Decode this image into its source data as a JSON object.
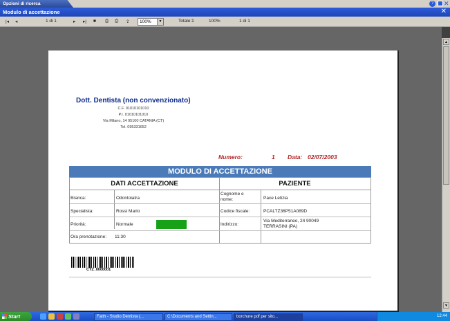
{
  "tab": {
    "label": "Opzioni di ricerca"
  },
  "window": {
    "title": "Modulo di accettazione"
  },
  "toolbar": {
    "page_indicator": "1 di 1",
    "zoom": "100%",
    "total": "Totale:1",
    "zoom_pct": "100%",
    "page_of": "1 di 1"
  },
  "doctor": {
    "name": "Dott. Dentista (non convenzionato)",
    "cf": "C.F. 01010101010",
    "pi": "P.I. 01010101010",
    "address": "Via Milano, 14  95100 CATANIA (CT)",
    "tel": "Tel. 095331652"
  },
  "header": {
    "numero_label": "Numero:",
    "numero_value": "1",
    "data_label": "Data:",
    "data_value": "02/07/2003"
  },
  "form": {
    "title": "MODULO DI ACCETTAZIONE",
    "section_left": "DATI ACCETTAZIONE",
    "section_right": "PAZIENTE",
    "branca_label": "Branca:",
    "branca_value": "Odontoiatra",
    "specialista_label": "Specialista:",
    "specialista_value": "Rossi Mario",
    "priorita_label": "Priorità:",
    "priorita_value": "Normale",
    "ora_label": "Ora prenotazione:",
    "ora_value": "11:30",
    "cognome_label": "Cognome e nome:",
    "cognome_value": "Pace  Letizia",
    "cf_label": "Codice fiscale:",
    "cf_value": "PCALTZ36P51A089D",
    "indirizzo_label": "Indirizzo:",
    "indirizzo_value1": "Via Mediterraneo, 24   90049",
    "indirizzo_value2": "TERRASINI (PA)"
  },
  "barcode": {
    "label": "CTZ_0000001"
  },
  "taskbar": {
    "start": "Start",
    "tasks": [
      "Faith - Studio Dentista (...",
      "C:\\Documents and Settin...",
      "borchure pdf per sito..."
    ],
    "clock": "12:44"
  },
  "colors": {
    "accent": "#4a7ab8",
    "title_blue": "#0f2d8c",
    "numero_red": "#b22222",
    "priority_green": "#16a116"
  }
}
